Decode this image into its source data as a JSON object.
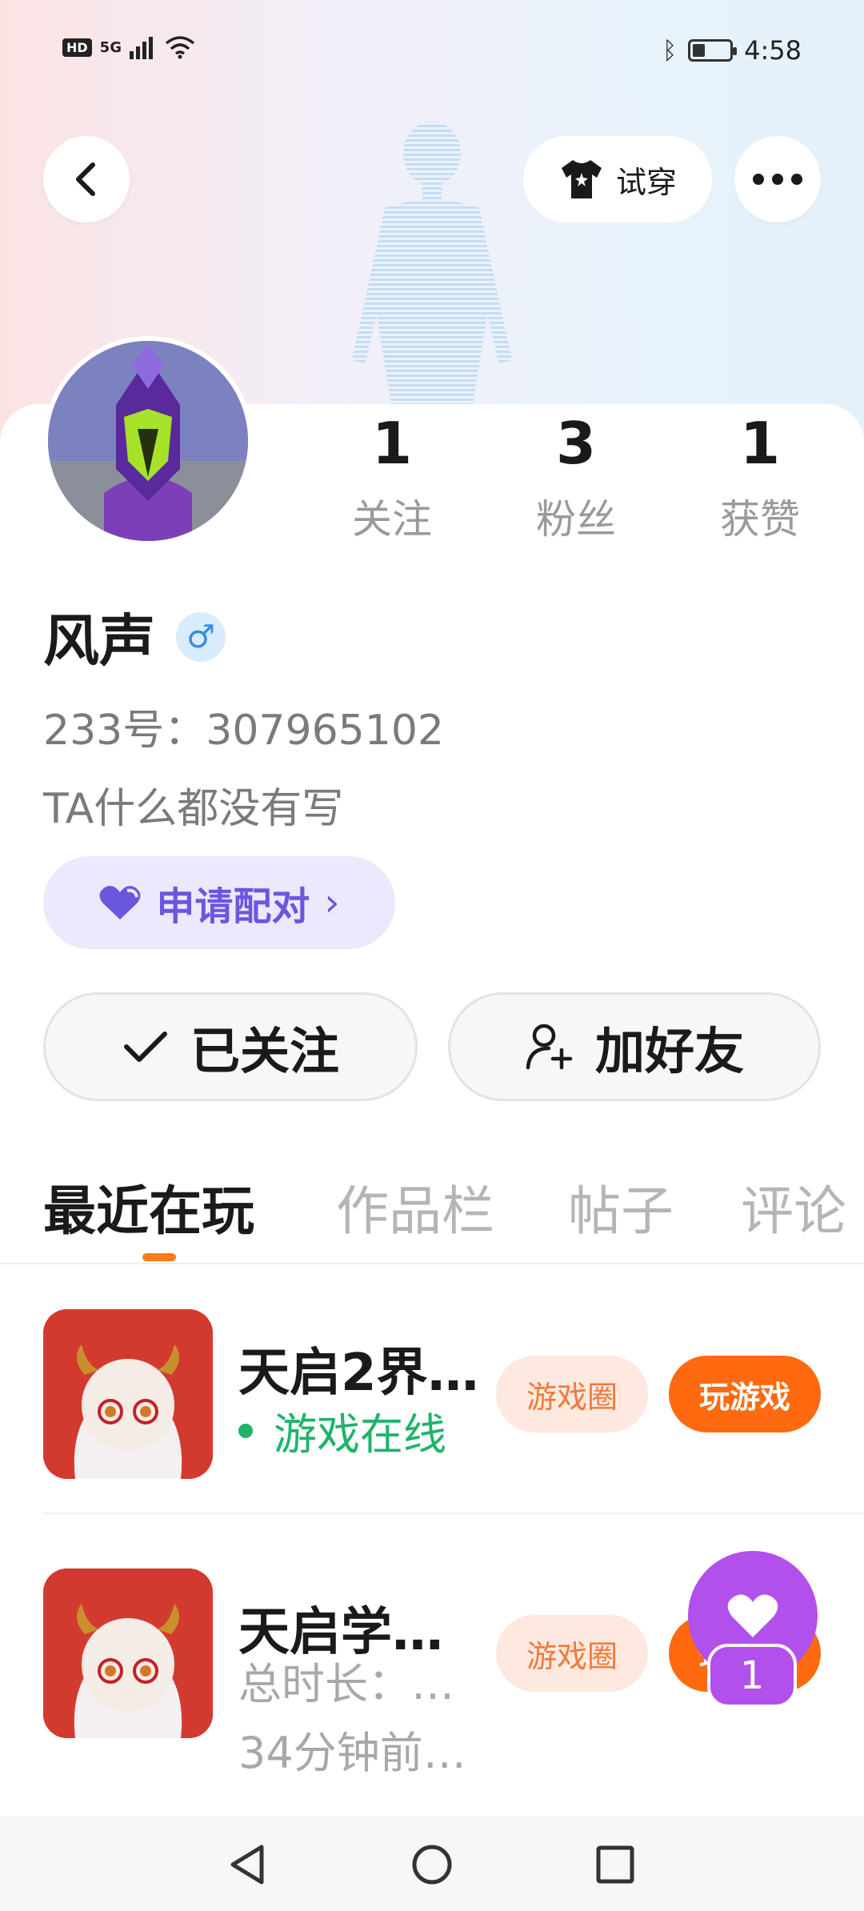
{
  "status_bar": {
    "hd": "HD",
    "signal": "5G",
    "time": "4:58",
    "battery_level": 0.35
  },
  "header": {
    "try_on_label": "试穿"
  },
  "stats": [
    {
      "value": "1",
      "label": "关注"
    },
    {
      "value": "3",
      "label": "粉丝"
    },
    {
      "value": "1",
      "label": "获赞"
    }
  ],
  "profile": {
    "name": "风声",
    "gender_symbol": "♂",
    "id_line": "233号：307965102",
    "bio": "TA什么都没有写"
  },
  "pair_button": {
    "label": "申请配对",
    "chevron": "›"
  },
  "actions": {
    "follow_label": "已关注",
    "add_friend_label": "加好友"
  },
  "tabs": [
    "最近在玩",
    "作品栏",
    "帖子",
    "评论"
  ],
  "games": [
    {
      "title": "天启2界…",
      "sub": "游戏在线",
      "circle_label": "游戏圈",
      "play_label": "玩游戏"
    },
    {
      "title": "天启学…",
      "sub": "总时长：…",
      "sub2": "34分钟前…",
      "circle_label": "游戏圈",
      "play_label": "玩游戏"
    }
  ],
  "like_fab": {
    "count": "1"
  },
  "colors": {
    "accent": "#ff6a10",
    "purple": "#b250ec",
    "online_green": "#1fb36b"
  }
}
